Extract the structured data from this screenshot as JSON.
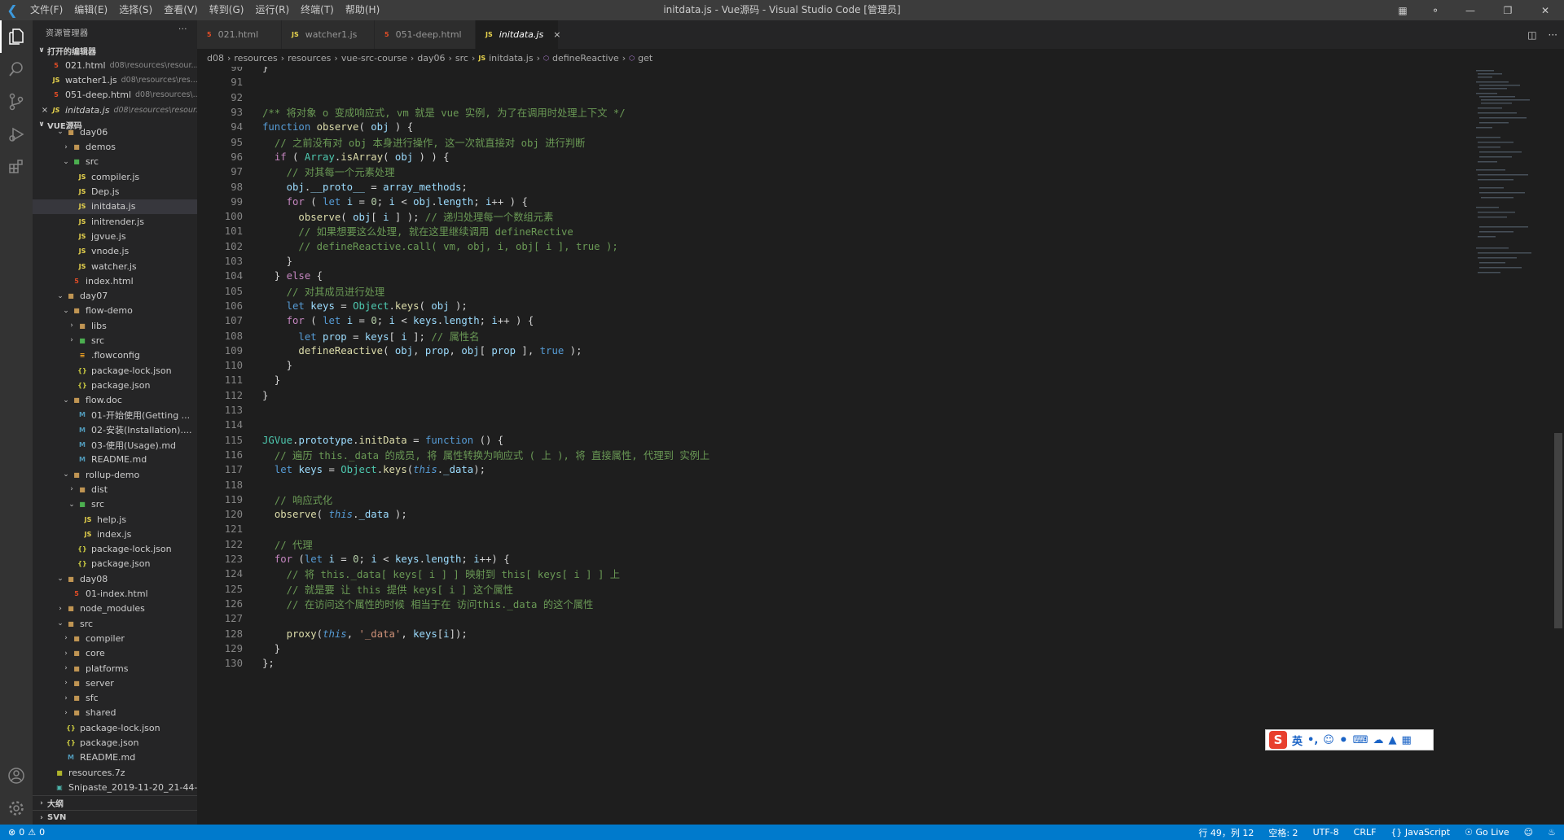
{
  "window": {
    "title": "initdata.js - Vue源码 - Visual Studio Code [管理员]",
    "menu": [
      "文件(F)",
      "编辑(E)",
      "选择(S)",
      "查看(V)",
      "转到(G)",
      "运行(R)",
      "终端(T)",
      "帮助(H)"
    ]
  },
  "sidebar": {
    "title": "资源管理器",
    "open_editors_label": "打开的编辑器",
    "open_editors": [
      {
        "name": "021.html",
        "path": "d08\\resources\\resour...",
        "icon": "html"
      },
      {
        "name": "watcher1.js",
        "path": "d08\\resources\\res...",
        "icon": "js"
      },
      {
        "name": "051-deep.html",
        "path": "d08\\resources\\...",
        "icon": "html"
      },
      {
        "name": "initdata.js",
        "path": "d08\\resources\\resour...",
        "icon": "js"
      }
    ],
    "root_label": "VUE源码",
    "tree": [
      {
        "name": "day06"
      },
      {
        "name": "demos"
      },
      {
        "name": "src"
      },
      {
        "name": "compiler.js"
      },
      {
        "name": "Dep.js"
      },
      {
        "name": "initdata.js"
      },
      {
        "name": "initrender.js"
      },
      {
        "name": "jgvue.js"
      },
      {
        "name": "vnode.js"
      },
      {
        "name": "watcher.js"
      },
      {
        "name": "index.html"
      },
      {
        "name": "day07"
      },
      {
        "name": "flow-demo"
      },
      {
        "name": "libs"
      },
      {
        "name": "src"
      },
      {
        "name": ".flowconfig"
      },
      {
        "name": "package-lock.json"
      },
      {
        "name": "package.json"
      },
      {
        "name": "flow.doc"
      },
      {
        "name": "01-开始使用(Getting ..."
      },
      {
        "name": "02-安装(Installation)...."
      },
      {
        "name": "03-使用(Usage).md"
      },
      {
        "name": "README.md"
      },
      {
        "name": "rollup-demo"
      },
      {
        "name": "dist"
      },
      {
        "name": "src"
      },
      {
        "name": "help.js"
      },
      {
        "name": "index.js"
      },
      {
        "name": "package-lock.json"
      },
      {
        "name": "package.json"
      },
      {
        "name": "day08"
      },
      {
        "name": "01-index.html"
      },
      {
        "name": "node_modules"
      },
      {
        "name": "src"
      },
      {
        "name": "compiler"
      },
      {
        "name": "core"
      },
      {
        "name": "platforms"
      },
      {
        "name": "server"
      },
      {
        "name": "sfc"
      },
      {
        "name": "shared"
      },
      {
        "name": "package-lock.json"
      },
      {
        "name": "package.json"
      },
      {
        "name": "README.md"
      },
      {
        "name": "resources.7z"
      },
      {
        "name": "Snipaste_2019-11-20_21-44-..."
      }
    ],
    "footer": [
      "大纲",
      "SVN"
    ]
  },
  "tabs": [
    {
      "label": "021.html",
      "icon": "html"
    },
    {
      "label": "watcher1.js",
      "icon": "js"
    },
    {
      "label": "051-deep.html",
      "icon": "html"
    },
    {
      "label": "initdata.js",
      "icon": "js"
    }
  ],
  "breadcrumb": [
    "d08",
    "resources",
    "resources",
    "vue-src-course",
    "day06",
    "src",
    "initdata.js",
    "defineReactive",
    "get"
  ],
  "editor": {
    "line_numbers": [
      "90",
      "91",
      "92",
      "93",
      "94",
      "95",
      "96",
      "97",
      "98",
      "99",
      "100",
      "101",
      "102",
      "103",
      "104",
      "105",
      "106",
      "107",
      "108",
      "109",
      "110",
      "111",
      "112",
      "113",
      "114",
      "115",
      "116",
      "117",
      "118",
      "119",
      "120",
      "121",
      "122",
      "123",
      "124",
      "125",
      "126",
      "127",
      "128",
      "129",
      "130"
    ]
  },
  "ime": {
    "logo": "S",
    "mode": "英"
  },
  "statusbar": {
    "errors": "0",
    "warnings": "0",
    "position": "行 49，列 12",
    "spaces": "空格: 2",
    "encoding": "UTF-8",
    "eol": "CRLF",
    "language": "JavaScript",
    "golive": "Go Live"
  },
  "colors": {
    "accent": "#007acc",
    "editor_bg": "#1e1e1e",
    "sidebar_bg": "#252526"
  }
}
